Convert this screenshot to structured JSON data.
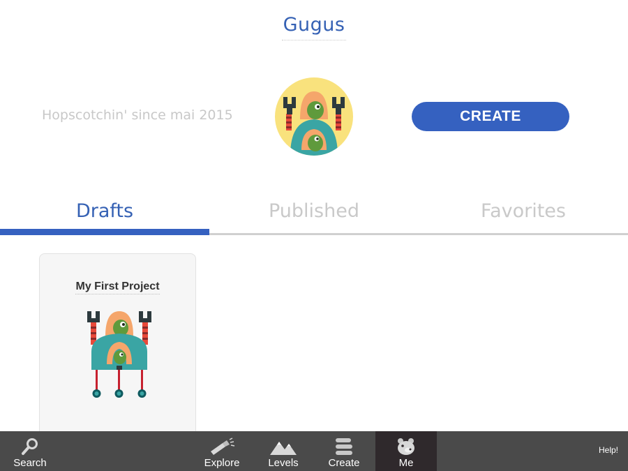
{
  "profile": {
    "username": "Gugus",
    "since_text": "Hopscotchin' since mai 2015",
    "create_label": "CREATE"
  },
  "tabs": [
    {
      "label": "Drafts",
      "active": true
    },
    {
      "label": "Published",
      "active": false
    },
    {
      "label": "Favorites",
      "active": false
    }
  ],
  "projects": [
    {
      "title": "My First Project",
      "thumbnail_icon": "robot-icon"
    }
  ],
  "bottom_bar": {
    "items": [
      {
        "label": "Search",
        "icon": "search-icon"
      },
      {
        "label": "Explore",
        "icon": "flashlight-icon"
      },
      {
        "label": "Levels",
        "icon": "mountains-icon"
      },
      {
        "label": "Create",
        "icon": "layers-icon"
      },
      {
        "label": "Me",
        "icon": "bear-icon",
        "active": true
      }
    ],
    "help_label": "Help!"
  },
  "colors": {
    "accent": "#3561c0",
    "tab_bar": "#4a4a4a",
    "tab_bar_active": "#2f292c",
    "avatar_bg": "#f9e27d",
    "inactive_text": "#c9c9c9"
  }
}
